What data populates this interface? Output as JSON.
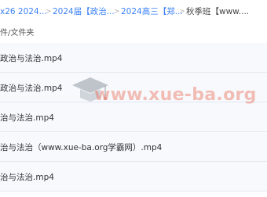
{
  "breadcrumb": {
    "items": [
      {
        "label": "x26 2024..."
      },
      {
        "label": "2024届【政治..."
      },
      {
        "label": "2024高三【郑..."
      },
      {
        "label": "秋季班【www...."
      }
    ]
  },
  "list_header": {
    "label": "件/文件夹"
  },
  "files": [
    {
      "name": "政治与法治.mp4"
    },
    {
      "name": "政治与法治.mp4"
    },
    {
      "name": "治与法治.mp4"
    },
    {
      "name": "治与法治（www.xue-ba.org学霸网）.mp4"
    },
    {
      "name": "治与法治.mp4"
    }
  ],
  "watermark": {
    "text": "www.xue-ba.org",
    "icon": "graduation-cap-icon"
  },
  "colors": {
    "link": "#3b82f6",
    "row_bg": "#f7f9fd",
    "watermark": "#e9705c"
  }
}
